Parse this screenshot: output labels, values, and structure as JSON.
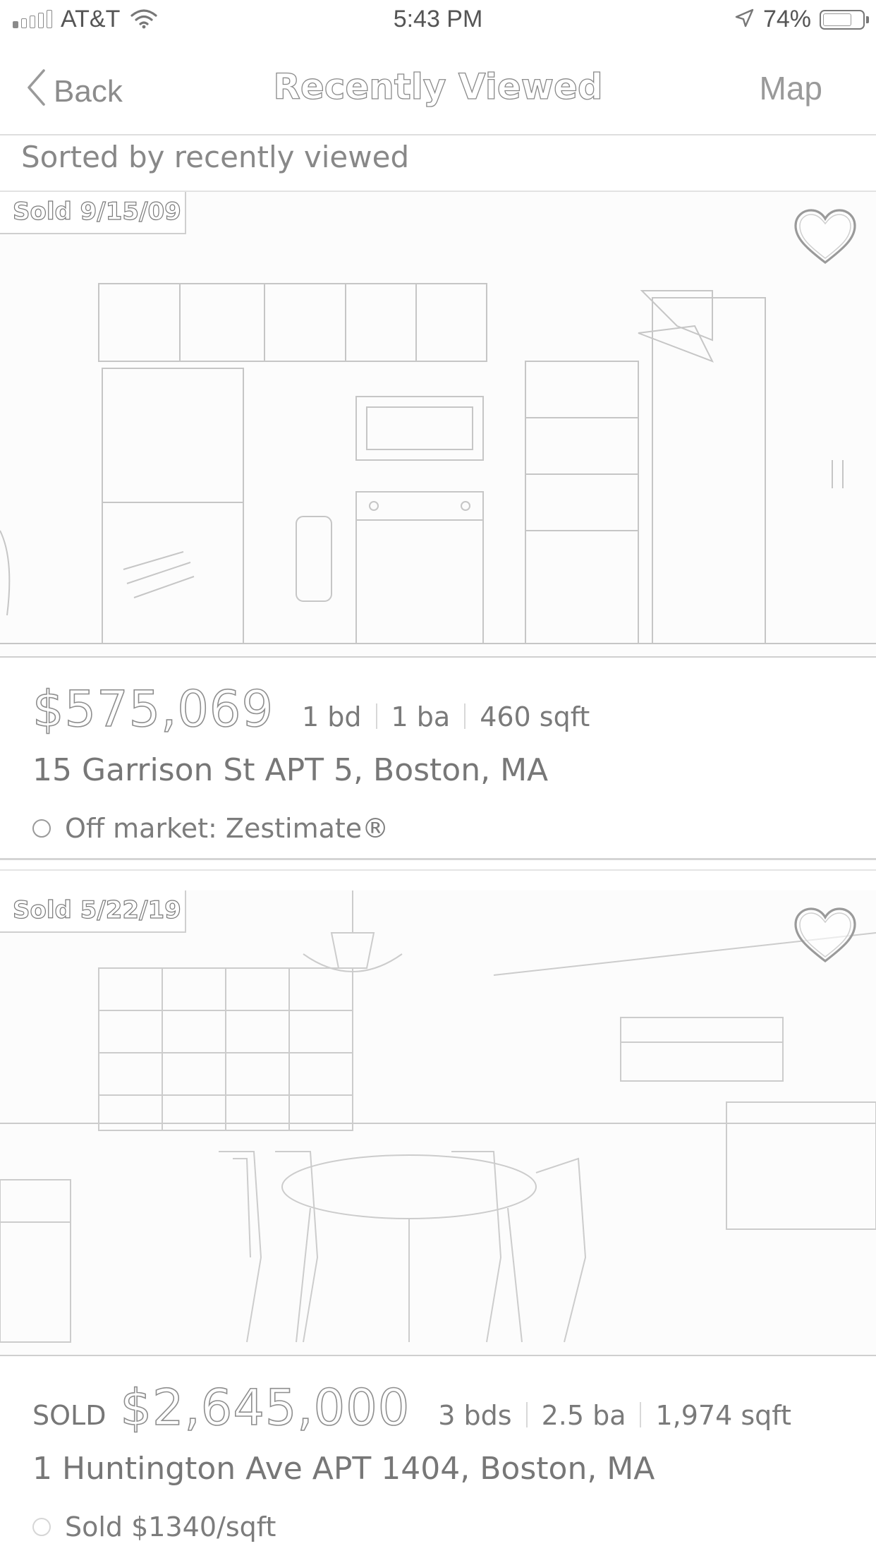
{
  "status_bar": {
    "carrier": "AT&T",
    "time": "5:43 PM",
    "battery_percent": "74%",
    "battery_level": 0.74,
    "icons": [
      "signal-icon",
      "wifi-icon",
      "location-arrow-icon",
      "battery-icon"
    ]
  },
  "nav": {
    "back_label": "Back",
    "title": "Recently Viewed",
    "map_label": "Map"
  },
  "sort": {
    "label": "Sorted by recently viewed"
  },
  "listings": [
    {
      "sold_tag": "Sold 9/15/09",
      "sold_prefix": "",
      "price": "$575,069",
      "beds": "1 bd",
      "baths": "1 ba",
      "sqft": "460 sqft",
      "address": "15 Garrison St APT 5, Boston, MA",
      "status": "Off market: Zestimate®",
      "favorite_icon": "heart-outline-icon",
      "photo_subject": "kitchen"
    },
    {
      "sold_tag": "Sold 5/22/19",
      "sold_prefix": "SOLD",
      "price": "$2,645,000",
      "beds": "3 bds",
      "baths": "2.5 ba",
      "sqft": "1,974 sqft",
      "address": "1 Huntington Ave APT 1404, Boston, MA",
      "status": "Sold $1340/sqft",
      "favorite_icon": "heart-outline-icon",
      "photo_subject": "dining room"
    }
  ],
  "colors": {
    "line": "#8a8a8a",
    "text": "#777777",
    "background": "#ffffff"
  }
}
